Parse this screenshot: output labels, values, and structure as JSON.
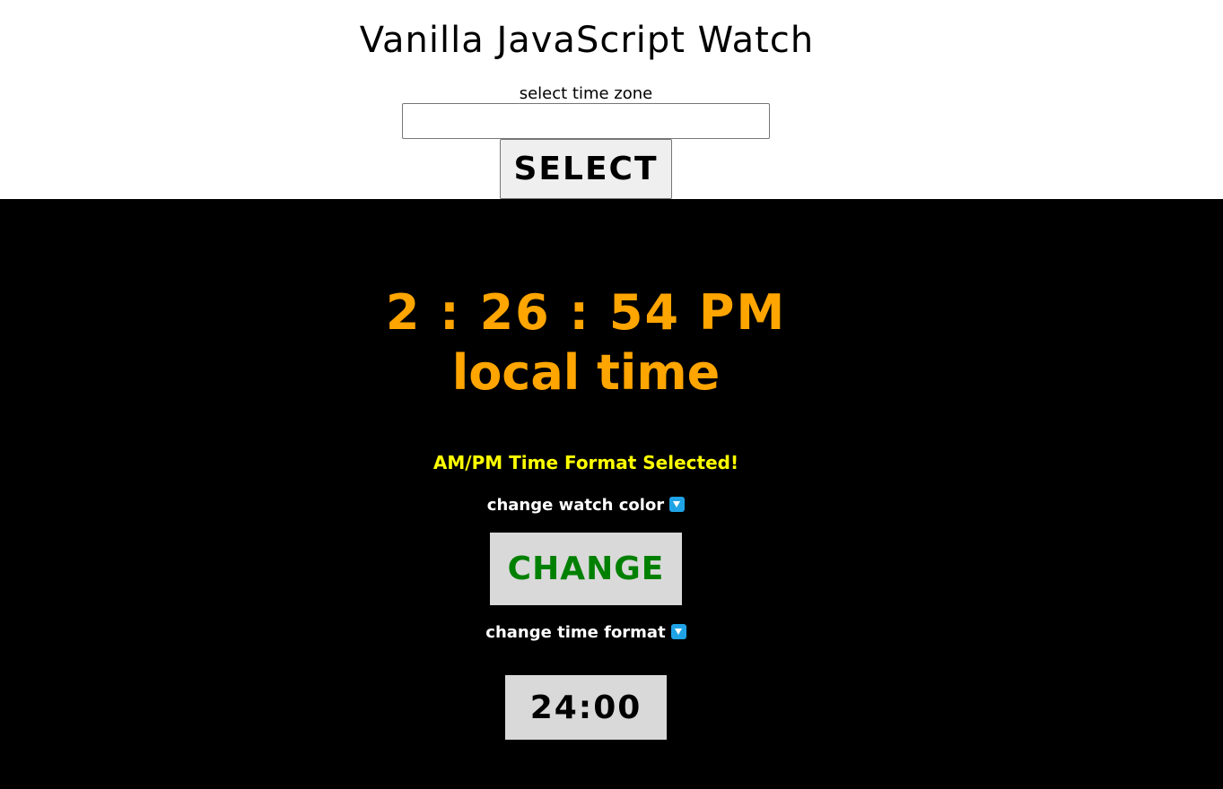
{
  "header": {
    "title": "Vanilla JavaScript Watch",
    "timezone_label": "select time zone",
    "timezone_value": "",
    "select_button": "SELECT"
  },
  "watch": {
    "time": "2 : 26 : 54 PM",
    "zone": "local time",
    "format_message": "AM/PM Time Format Selected!",
    "change_color_label": "change watch color",
    "change_button": "CHANGE",
    "change_format_label": "change time format",
    "format_button": "24:00"
  },
  "colors": {
    "watch_text": "#ffa500",
    "message_text": "#ffff00",
    "change_button_text": "#008000",
    "background": "#000000",
    "icon": "#1fa3e6"
  },
  "icons": {
    "dropdown_indicator": "down-arrow-button-icon"
  }
}
